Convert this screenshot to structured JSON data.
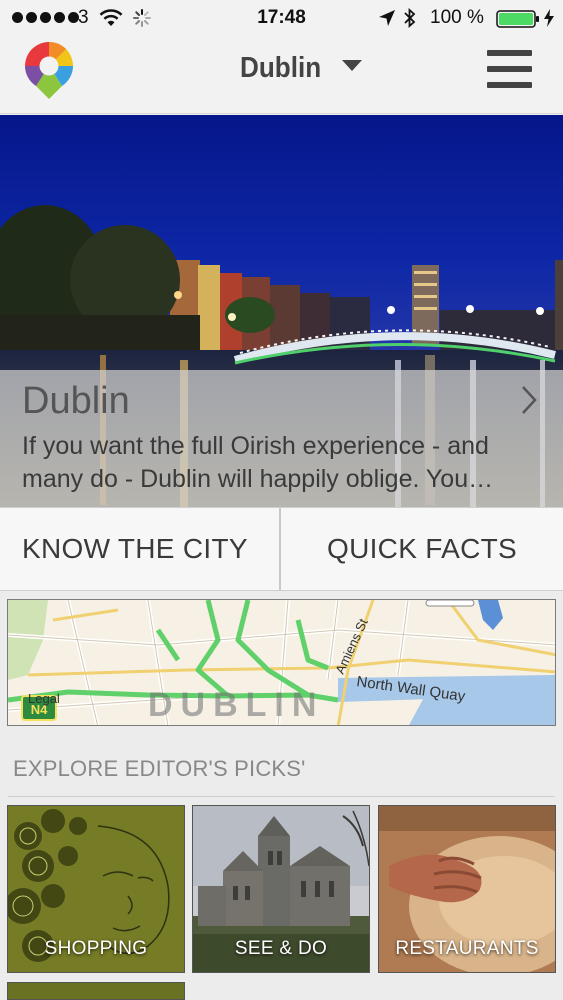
{
  "status_bar": {
    "carrier": "3",
    "time": "17:48",
    "battery_percent": "100 %"
  },
  "header": {
    "city": "Dublin",
    "logo_icon": "map-pin-logo-icon",
    "menu_icon": "hamburger-menu-icon"
  },
  "hero": {
    "title": "Dublin",
    "description": "If you want the full Oirish experience - and many do - Dublin will happily oblige. You…"
  },
  "tabs": {
    "know_the_city": "KNOW THE CITY",
    "quick_facts": "QUICK FACTS"
  },
  "map": {
    "legal": "Legal",
    "road_badge": "N4",
    "city_label": "DUBLIN",
    "street_amiens": "Amiens St",
    "street_north_wall": "North Wall Quay"
  },
  "editors_picks": {
    "title": "EXPLORE EDITOR'S PICKS'",
    "tiles": [
      {
        "label": "SHOPPING"
      },
      {
        "label": "SEE & DO"
      },
      {
        "label": "RESTAURANTS"
      }
    ]
  },
  "colors": {
    "night_sky": "#081b8a",
    "map_route_green": "#5fd06a",
    "battery_green": "#4cd964"
  }
}
